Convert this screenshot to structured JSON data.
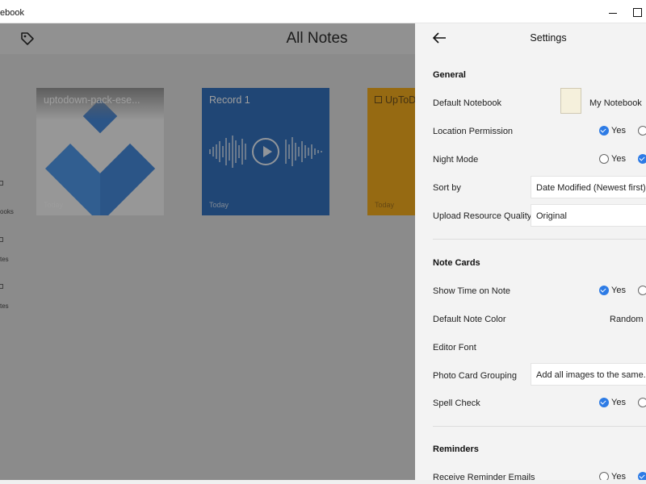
{
  "window": {
    "title": "ebook"
  },
  "header": {
    "title": "All Notes"
  },
  "sidebar": {
    "items": [
      {
        "label": "ooks",
        "icon": "notebook-icon"
      },
      {
        "label": "tes",
        "icon": "note-icon"
      },
      {
        "label": "tes",
        "icon": "note-icon"
      }
    ]
  },
  "notes": [
    {
      "title": "uptodown-pack-ese...",
      "date": "Today"
    },
    {
      "title": "Record 1",
      "date": "Today"
    },
    {
      "title": "UpToDo",
      "date": "Today"
    }
  ],
  "settings": {
    "title": "Settings",
    "general": {
      "heading": "General",
      "default_notebook": {
        "label": "Default Notebook",
        "value": "My Notebook"
      },
      "location_permission": {
        "label": "Location Permission",
        "yes": "Yes",
        "selected": "yes"
      },
      "night_mode": {
        "label": "Night Mode",
        "yes": "Yes",
        "selected": "no"
      },
      "sort_by": {
        "label": "Sort by",
        "value": "Date Modified (Newest first)"
      },
      "upload_quality": {
        "label": "Upload Resource Quality",
        "value": "Original"
      }
    },
    "note_cards": {
      "heading": "Note Cards",
      "show_time": {
        "label": "Show Time on Note",
        "yes": "Yes",
        "selected": "yes"
      },
      "default_color": {
        "label": "Default Note Color",
        "value": "Random"
      },
      "editor_font": {
        "label": "Editor Font"
      },
      "photo_grouping": {
        "label": "Photo Card Grouping",
        "value": "Add all images to the same..."
      },
      "spell_check": {
        "label": "Spell Check",
        "yes": "Yes",
        "selected": "yes"
      }
    },
    "reminders": {
      "heading": "Reminders",
      "receive_emails": {
        "label": "Receive Reminder Emails",
        "yes": "Yes",
        "selected": "no"
      }
    }
  },
  "colors": {
    "accent": "#2d7be5",
    "record_card": "#1a5fb4",
    "todo_card": "#f0a000"
  }
}
